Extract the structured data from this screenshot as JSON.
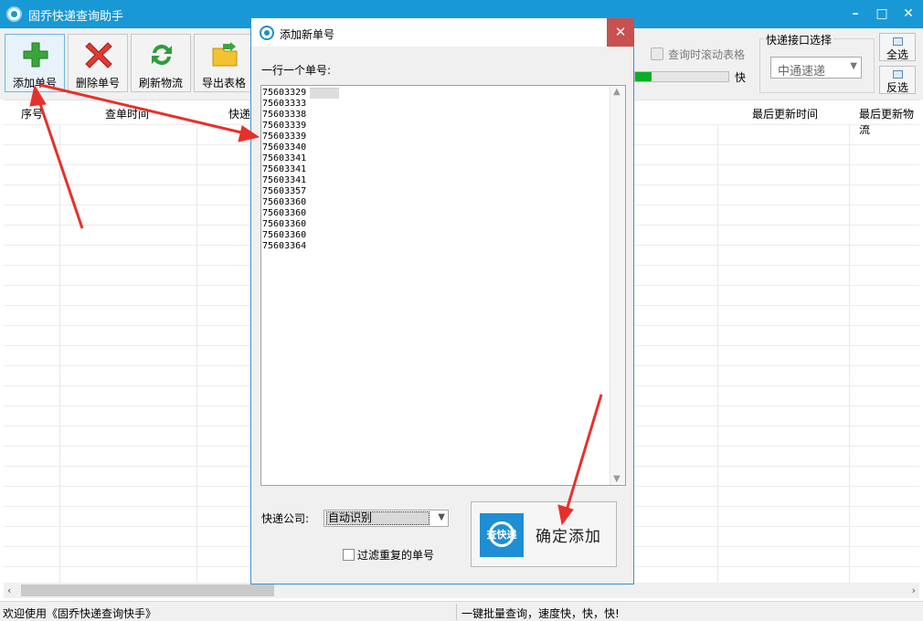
{
  "window": {
    "title": "固乔快递查询助手",
    "controls": {
      "minimize": "–",
      "maximize": "□",
      "close": "✕"
    }
  },
  "toolbar": {
    "buttons": [
      {
        "label": "添加单号",
        "icon": "plus-icon"
      },
      {
        "label": "删除单号",
        "icon": "delete-x-icon"
      },
      {
        "label": "刷新物流",
        "icon": "refresh-icon"
      },
      {
        "label": "导出表格",
        "icon": "folder-export-icon"
      }
    ],
    "scroll_table_label": "查询时滚动表格",
    "speed_label": "快",
    "speed_progress_percent": 18,
    "interface_group": "快递接口选择",
    "interface_selected": "中通速递",
    "select_all": "全选",
    "invert_select": "反选"
  },
  "grid": {
    "columns": [
      "序号",
      "查单时间",
      "快递",
      "最后更新时间",
      "最后更新物流"
    ]
  },
  "statusbar": {
    "left": "欢迎使用《固乔快递查询快手》",
    "right": "一键批量查询，速度快，快，快!"
  },
  "dialog": {
    "title": "添加新单号",
    "close": "✕",
    "prompt": "一行一个单号:",
    "numbers": [
      "75603329",
      "75603333",
      "75603338",
      "75603339",
      "75603339",
      "75603340",
      "75603341",
      "75603341",
      "75603341",
      "75603357",
      "75603360",
      "75603360",
      "75603360",
      "75603360",
      "75603364"
    ],
    "company_label": "快递公司:",
    "company_value": "自动识别",
    "filter_label": "过滤重复的单号",
    "confirm_logo_text": "查快递",
    "confirm_label": "确定添加"
  },
  "colors": {
    "titlebar": "#1899d6",
    "dialog_close": "#c75050",
    "annotation_arrow": "#e8302a",
    "progress": "#06b025"
  }
}
